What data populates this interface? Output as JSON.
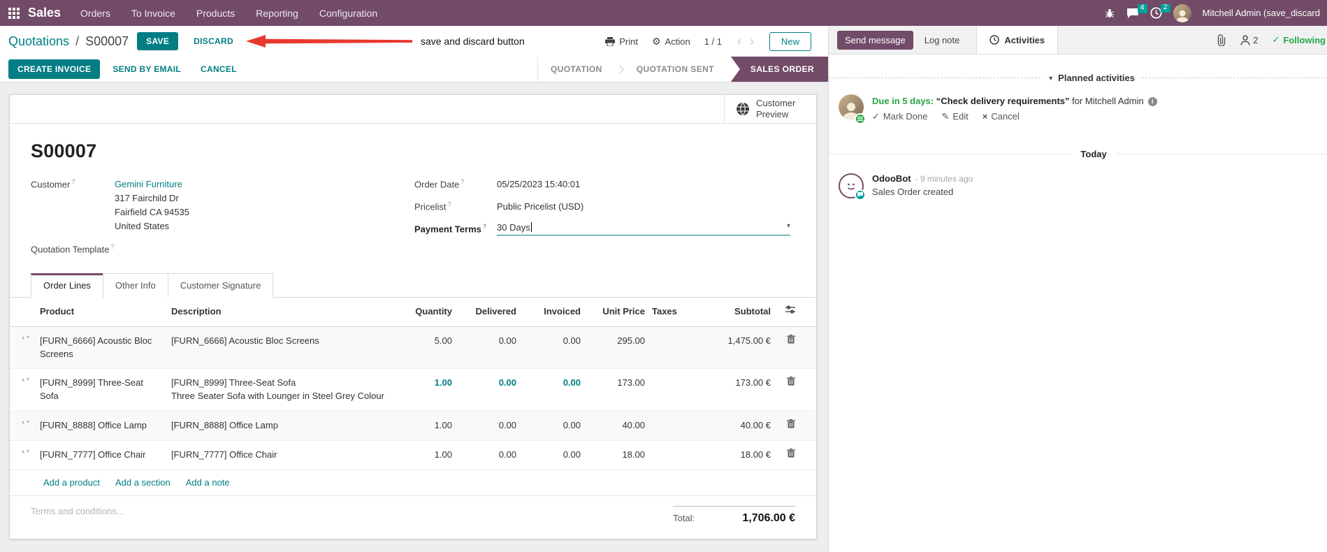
{
  "colors": {
    "purple": "#714B67",
    "teal": "#017E84",
    "green": "#28a745",
    "red": "#E8392E",
    "badge": "#00A09D"
  },
  "navbar": {
    "app": "Sales",
    "menus": [
      "Orders",
      "To Invoice",
      "Products",
      "Reporting",
      "Configuration"
    ],
    "message_badge": "4",
    "activity_badge": "2",
    "user": "Mitchell Admin (save_discard"
  },
  "control": {
    "breadcrumb_parent": "Quotations",
    "breadcrumb_sep": "/",
    "breadcrumb_current": "S00007",
    "save": "SAVE",
    "discard": "DISCARD",
    "annotation": "save and discard button",
    "print": "Print",
    "action": "Action",
    "pager": "1 / 1",
    "prev": "‹",
    "next": "›",
    "new": "New"
  },
  "statusbar": {
    "buttons": [
      "CREATE INVOICE",
      "SEND BY EMAIL",
      "CANCEL"
    ],
    "states": [
      "QUOTATION",
      "QUOTATION SENT",
      "SALES ORDER"
    ],
    "active_state": "SALES ORDER"
  },
  "sheet": {
    "preview_button": "Customer Preview",
    "title": "S00007",
    "help_marker": "?",
    "customer_label": "Customer",
    "customer_name": "Gemini Furniture",
    "customer_address": [
      "317 Fairchild Dr",
      "Fairfield CA 94535",
      "United States"
    ],
    "quotation_template_label": "Quotation Template",
    "order_date_label": "Order Date",
    "order_date": "05/25/2023 15:40:01",
    "pricelist_label": "Pricelist",
    "pricelist": "Public Pricelist (USD)",
    "payment_terms_label": "Payment Terms",
    "payment_terms": "30 Days",
    "dropdown_caret": "▾",
    "terms_placeholder": "Terms and conditions..."
  },
  "tabs": [
    {
      "label": "Order Lines",
      "active": true
    },
    {
      "label": "Other Info",
      "active": false
    },
    {
      "label": "Customer Signature",
      "active": false
    }
  ],
  "order_lines": {
    "columns": [
      "Product",
      "Description",
      "Quantity",
      "Delivered",
      "Invoiced",
      "Unit Price",
      "Taxes",
      "Subtotal"
    ],
    "rows": [
      {
        "product": "[FURN_6666] Acoustic Bloc Screens",
        "description": "[FURN_6666] Acoustic Bloc Screens",
        "description2": "",
        "quantity": "5.00",
        "delivered": "0.00",
        "invoiced": "0.00",
        "unit_price": "295.00",
        "taxes": "",
        "subtotal": "1,475.00 €"
      },
      {
        "product": "[FURN_8999] Three-Seat Sofa",
        "description": "[FURN_8999] Three-Seat Sofa",
        "description2": "Three Seater Sofa with Lounger in Steel Grey Colour",
        "quantity": "1.00",
        "delivered": "0.00",
        "invoiced": "0.00",
        "unit_price": "173.00",
        "taxes": "",
        "subtotal": "173.00 €"
      },
      {
        "product": "[FURN_8888] Office Lamp",
        "description": "[FURN_8888] Office Lamp",
        "description2": "",
        "quantity": "1.00",
        "delivered": "0.00",
        "invoiced": "0.00",
        "unit_price": "40.00",
        "taxes": "",
        "subtotal": "40.00 €"
      },
      {
        "product": "[FURN_7777] Office Chair",
        "description": "[FURN_7777] Office Chair",
        "description2": "",
        "quantity": "1.00",
        "delivered": "0.00",
        "invoiced": "0.00",
        "unit_price": "18.00",
        "taxes": "",
        "subtotal": "18.00 €"
      }
    ],
    "footer_links": [
      "Add a product",
      "Add a section",
      "Add a note"
    ],
    "total_label": "Total:",
    "total": "1,706.00 €"
  },
  "chatter": {
    "send_message": "Send message",
    "log_note": "Log note",
    "activities": "Activities",
    "followers_count": "2",
    "following": "Following",
    "planned_title": "Planned activities",
    "activity": {
      "due": "Due in 5 days:",
      "summary": "“Check delivery requirements”",
      "for_text": "for Mitchell Admin",
      "mark_done": "Mark Done",
      "edit": "Edit",
      "cancel": "Cancel"
    },
    "today": "Today",
    "message": {
      "author": "OdooBot",
      "time": "- 9 minutes ago",
      "body": "Sales Order created"
    }
  }
}
